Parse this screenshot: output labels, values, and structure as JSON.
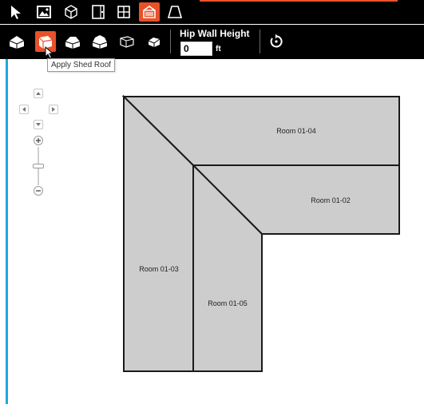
{
  "toolbar": {
    "tools": [
      {
        "icon": "select-arrow-icon",
        "active": false
      },
      {
        "icon": "image-icon",
        "active": false
      },
      {
        "icon": "cube-icon",
        "active": false
      },
      {
        "icon": "door-icon",
        "active": false
      },
      {
        "icon": "window-icon",
        "active": false
      },
      {
        "icon": "roof-icon",
        "active": true
      },
      {
        "icon": "trapezoid-icon",
        "active": false
      }
    ]
  },
  "roof_toolbar": {
    "hip_wall_height_label": "Hip Wall Height",
    "hip_wall_height_value": "0",
    "unit": "ft",
    "active_tool": "shed-roof"
  },
  "tooltip": "Apply Shed Roof",
  "rooms": [
    {
      "name": "Room 01-04"
    },
    {
      "name": "Room 01-02"
    },
    {
      "name": "Room 01-03"
    },
    {
      "name": "Room 01-05"
    }
  ],
  "colors": {
    "accent": "#e8512a",
    "sidebar_stripe": "#1ea7e1",
    "room_fill": "#cdcdcd",
    "toolbar_bg": "#000000"
  }
}
